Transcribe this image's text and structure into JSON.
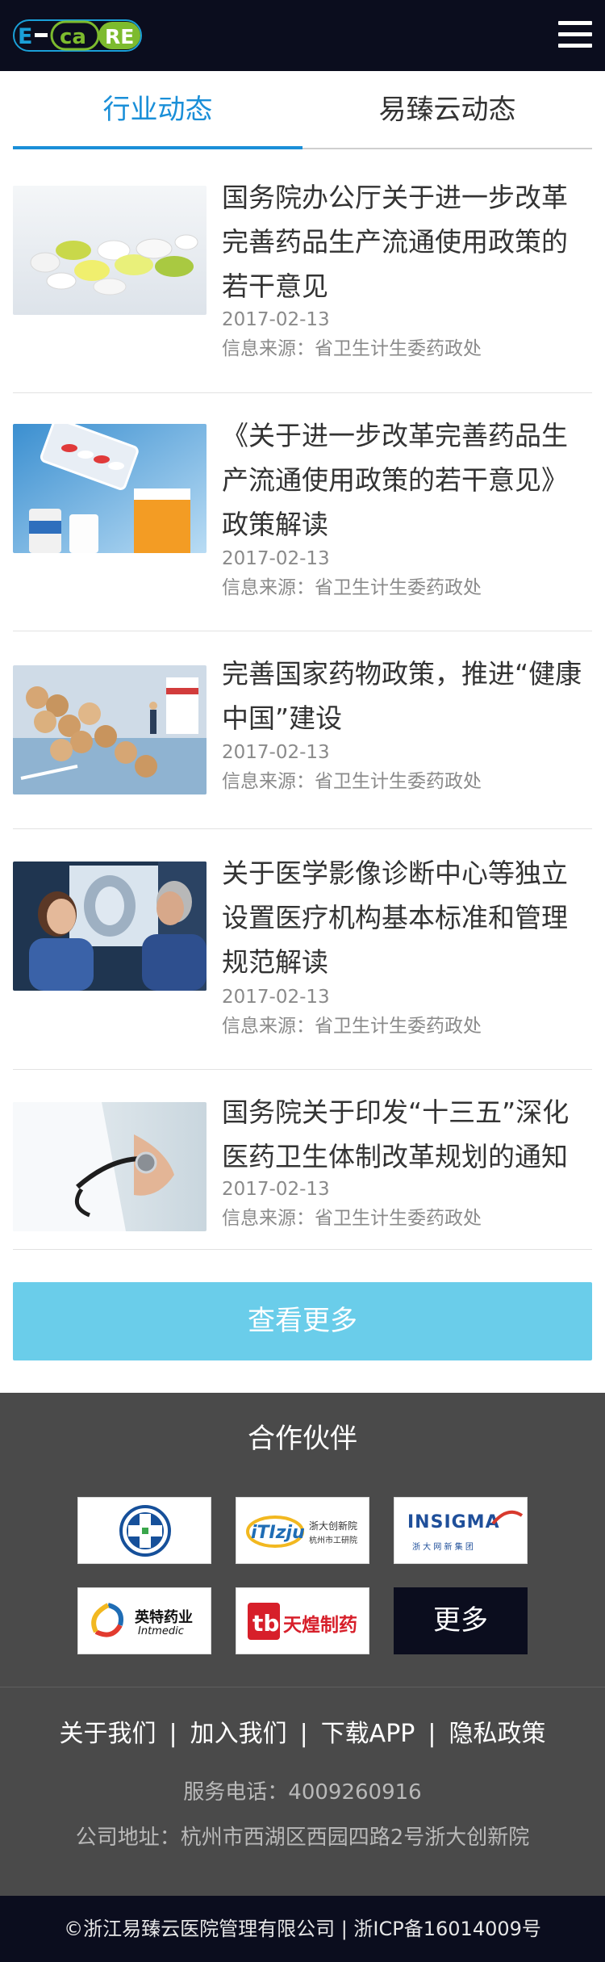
{
  "header": {
    "logo_text": "E-CARE",
    "menu_icon": "hamburger-menu-icon"
  },
  "tabs": [
    {
      "label": "行业动态",
      "active": true
    },
    {
      "label": "易臻云动态",
      "active": false
    }
  ],
  "news": [
    {
      "title": "国务院办公厅关于进一步改革完善药品生产流通使用政策的若干意见",
      "date": "2017-02-13",
      "source": "信息来源：省卫生计生委药政处",
      "thumb": "pills-on-white"
    },
    {
      "title": "《关于进一步改革完善药品生产流通使用政策的若干意见》政策解读",
      "date": "2017-02-13",
      "source": "信息来源：省卫生计生委药政处",
      "thumb": "medicine-bottles-capsules"
    },
    {
      "title": "完善国家药物政策，推进“健康中国”建设",
      "date": "2017-02-13",
      "source": "信息来源：省卫生计生委药政处",
      "thumb": "tablets-on-map"
    },
    {
      "title": "关于医学影像诊断中心等独立设置医疗机构基本标准和管理规范解读",
      "date": "2017-02-13",
      "source": "信息来源：省卫生计生委药政处",
      "thumb": "doctors-viewing-xray"
    },
    {
      "title": "国务院关于印发“十三五”深化医药卫生体制改革规划的通知",
      "date": "2017-02-13",
      "source": "信息来源：省卫生计生委药政处",
      "thumb": "doctor-stethoscope"
    }
  ],
  "more_button": "查看更多",
  "partners": {
    "title": "合作伙伴",
    "items": [
      {
        "name": "cross-emblem-logo",
        "text": ""
      },
      {
        "name": "zju-research-logo",
        "text": "浙大创新院",
        "sub": "杭州市工研院"
      },
      {
        "name": "insigma-logo",
        "text": "INSIGMA",
        "sub": "浙 大 网 新 集 团"
      },
      {
        "name": "yingte-pharma-logo",
        "text": "英特药业",
        "sub": "Intmedic"
      },
      {
        "name": "tianhuang-pharma-logo",
        "text": "天煌制药"
      }
    ],
    "more_label": "更多"
  },
  "footer": {
    "links": [
      "关于我们",
      "加入我们",
      "下载APP",
      "隐私政策"
    ],
    "separator": "|",
    "phone": "服务电话：4009260916",
    "address": "公司地址：杭州市西湖区西园四路2号浙大创新院"
  },
  "copyright": "©浙江易臻云医院管理有限公司 | 浙ICP备16014009号",
  "colors": {
    "header_bg": "#0b0d1e",
    "accent_blue": "#1a8fd8",
    "more_button_bg": "#6acdea",
    "footer_bg": "#4a4a4a",
    "logo_green": "#7dbb2e",
    "logo_blue": "#1aa0d8"
  }
}
